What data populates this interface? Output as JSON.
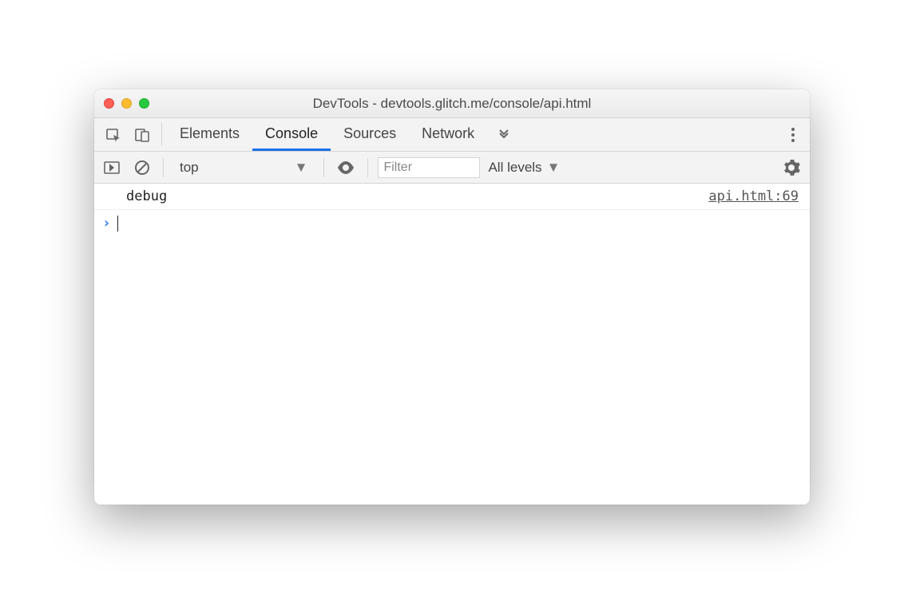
{
  "window": {
    "title": "DevTools - devtools.glitch.me/console/api.html"
  },
  "tabs": {
    "elements": "Elements",
    "console": "Console",
    "sources": "Sources",
    "network": "Network"
  },
  "toolbar": {
    "context": "top",
    "filter_placeholder": "Filter",
    "levels": "All levels"
  },
  "log": {
    "message": "debug",
    "source": "api.html:69"
  },
  "prompt": {
    "symbol": "›"
  }
}
